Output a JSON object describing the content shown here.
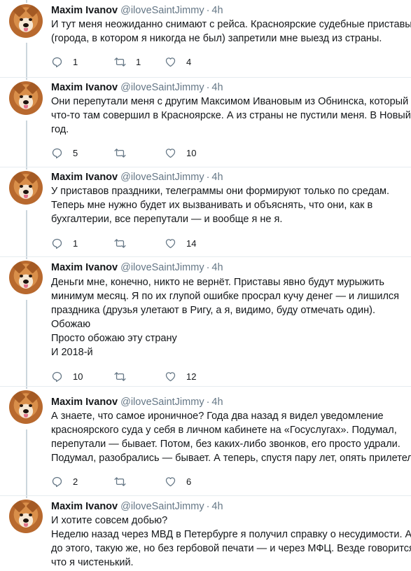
{
  "colors": {
    "text": "#14171a",
    "secondary": "#657786",
    "divider": "#e6ecf0",
    "thread_line": "#ccd6dd"
  },
  "tweets": [
    {
      "name": "Maxim Ivanov",
      "handle": "@iloveSaintJimmy",
      "sep": "·",
      "time": "4h",
      "lines": [
        "И тут меня неожиданно снимают с рейса. Красноярские судебные приставы",
        "(города, в котором я никогда не был) запретили мне выезд из страны."
      ],
      "replies": "1",
      "retweets": "1",
      "likes": "4"
    },
    {
      "name": "Maxim Ivanov",
      "handle": "@iloveSaintJimmy",
      "sep": "·",
      "time": "4h",
      "lines": [
        "Они перепутали меня с другим Максимом Ивановым из Обнинска, который",
        "что-то там совершил в Красноярске. А из страны не пустили меня. В Новый",
        "год."
      ],
      "replies": "5",
      "retweets": "",
      "likes": "10"
    },
    {
      "name": "Maxim Ivanov",
      "handle": "@iloveSaintJimmy",
      "sep": "·",
      "time": "4h",
      "lines": [
        "У приставов праздники, телеграммы они формируют только по средам.",
        "Теперь мне нужно будет их вызванивать и объяснять, что они, как в",
        "бухгалтерии, все перепутали — и вообще я не я."
      ],
      "replies": "1",
      "retweets": "",
      "likes": "14"
    },
    {
      "name": "Maxim Ivanov",
      "handle": "@iloveSaintJimmy",
      "sep": "·",
      "time": "4h",
      "lines": [
        "Деньги мне, конечно, никто не вернёт. Приставы явно будут мурыжить",
        "минимум месяц. Я по их глупой ошибке просрал кучу денег — и лишился",
        "праздника (друзья улетают в Ригу, а я, видимо, буду отмечать один).",
        "Обожаю",
        "Просто обожаю эту страну",
        "И 2018-й"
      ],
      "replies": "10",
      "retweets": "",
      "likes": "12"
    },
    {
      "name": "Maxim Ivanov",
      "handle": "@iloveSaintJimmy",
      "sep": "·",
      "time": "4h",
      "lines": [
        "А знаете, что самое ироничное? Года два назад я видел уведомление",
        "красноярского суда у себя в личном кабинете на «Госуслугах». Подумал,",
        "перепутали — бывает. Потом, без каких-либо звонков, его просто удрали.",
        "Подумал, разобрались — бывает. А теперь, спустя пару лет, опять прилетело"
      ],
      "replies": "2",
      "retweets": "",
      "likes": "6"
    },
    {
      "name": "Maxim Ivanov",
      "handle": "@iloveSaintJimmy",
      "sep": "·",
      "time": "4h",
      "lines": [
        "И хотите совсем добью?",
        "Неделю назад через МВД в Петербурге я получил справку о несудимости. А",
        "до этого, такую же, но без гербовой печати — и через МФЦ. Везде говорится,",
        "что я чистенький."
      ],
      "replies": "",
      "retweets": "",
      "likes": ""
    }
  ]
}
